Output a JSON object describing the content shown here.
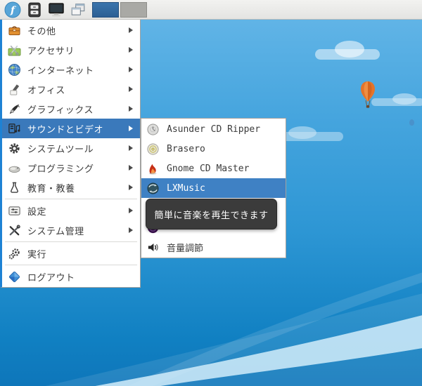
{
  "desktop": {
    "wallpaper_elements": [
      "clouds",
      "orange-hot-air-balloon",
      "small-blue-balloon",
      "light-wave-curves"
    ],
    "sky_top_color": "#66b7e8",
    "sky_bottom_color": "#0e76ba"
  },
  "taskbar": {
    "background_color": "#e8e8e6",
    "buttons": [
      {
        "name": "menu-button",
        "icon": "fedora-logo-icon"
      },
      {
        "name": "file-manager-button",
        "icon": "file-cabinet-icon"
      },
      {
        "name": "desktop-button",
        "icon": "monitor-icon"
      },
      {
        "name": "windows-button",
        "icon": "overlapping-windows-icon"
      }
    ],
    "pager": {
      "workspace_count": 2,
      "active_workspace": 1,
      "active_color": "#2b5f94",
      "inactive_color": "#a9a9a5"
    }
  },
  "menu": {
    "highlight_color": "#3a79bb",
    "items": [
      {
        "label": "その他",
        "icon": "toolbox-icon",
        "has_submenu": true
      },
      {
        "label": "アクセサリ",
        "icon": "accessories-scissors-icon",
        "has_submenu": true
      },
      {
        "label": "インターネット",
        "icon": "globe-icon",
        "has_submenu": true
      },
      {
        "label": "オフィス",
        "icon": "office-pen-cup-icon",
        "has_submenu": true
      },
      {
        "label": "グラフィックス",
        "icon": "graphics-pen-icon",
        "has_submenu": true
      },
      {
        "label": "サウンドとビデオ",
        "icon": "sound-video-icon",
        "has_submenu": true,
        "highlighted": true
      },
      {
        "label": "システムツール",
        "icon": "gear-icon",
        "has_submenu": true
      },
      {
        "label": "プログラミング",
        "icon": "programming-icon",
        "has_submenu": true
      },
      {
        "label": "教育・教養",
        "icon": "flask-icon",
        "has_submenu": true
      },
      {
        "label": "設定",
        "icon": "preferences-sliders-icon",
        "has_submenu": true
      },
      {
        "label": "システム管理",
        "icon": "admin-tools-icon",
        "has_submenu": true
      },
      {
        "label": "実行",
        "icon": "run-gears-icon",
        "has_submenu": false
      },
      {
        "label": "ログアウト",
        "icon": "logout-diamond-icon",
        "has_submenu": false
      }
    ]
  },
  "submenu": {
    "highlight_color": "#3f81c4",
    "items": [
      {
        "label": "Asunder CD Ripper",
        "icon": "cd-ripper-disc-icon"
      },
      {
        "label": "Brasero",
        "icon": "brasero-disc-icon"
      },
      {
        "label": "Gnome CD Master",
        "icon": "flame-disc-icon"
      },
      {
        "label": "LXMusic",
        "icon": "lxmusic-sphere-icon",
        "highlighted": true
      },
      {
        "label": "",
        "icon": "partially-hidden-app-icon",
        "hidden_by_tooltip": true
      },
      {
        "label": "",
        "icon": "partially-hidden-purple-disc-icon",
        "hidden_by_tooltip": true
      },
      {
        "label": "音量調節",
        "icon": "speaker-icon"
      }
    ]
  },
  "tooltip": {
    "text": "簡単に音楽を再生できます",
    "background_color": "#3b3b3b",
    "text_color": "#ffffff"
  }
}
